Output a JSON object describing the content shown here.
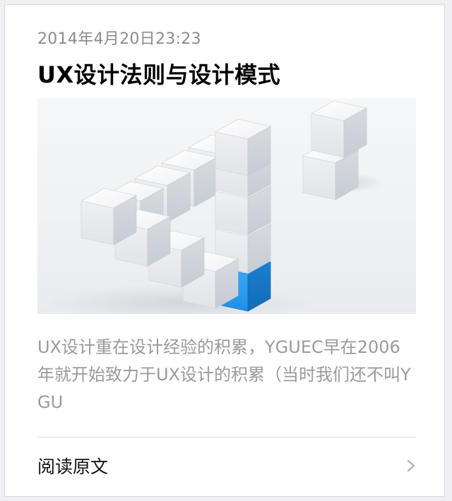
{
  "article": {
    "date": "2014年4月20日23:23",
    "title": "UX设计法则与设计模式",
    "cover_image": "3d-impossible-cube-triangle-illustration",
    "digest": "UX设计重在设计经验的积累，YGUEC早在2006年就开始致力于UX设计的积累（当时我们还不叫YGU",
    "read_more_label": "阅读原文",
    "read_more_icon": "chevron-right-icon",
    "accent_color": "#1e90e6"
  }
}
